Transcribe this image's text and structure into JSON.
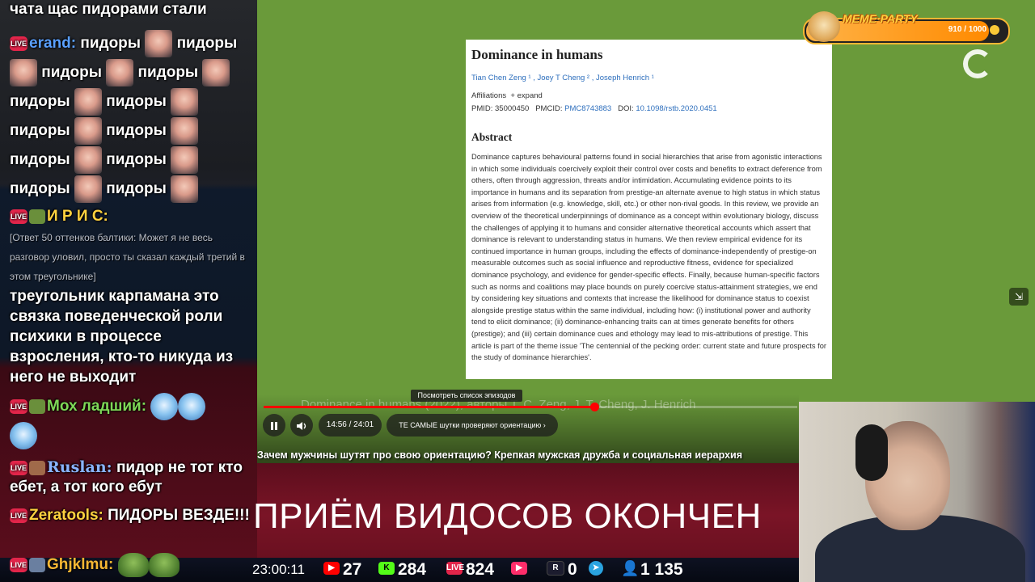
{
  "chat": {
    "msg0_text": "чата щас пидорами стали",
    "msg1_user": "erand:",
    "spam_word": "пидоры",
    "msg2_user": "И Р И С:",
    "msg2_quote": "[Ответ 50 оттенков балтики: Может я не весь разговор уловил, просто ты сказал каждый третий в этом треугольнике]",
    "msg3_text": "треугольник карпамана это связка поведенческой роли психики в процессе взросления, кто-то никуда из него не выходит",
    "msg4_user": "Мох ладший:",
    "msg5_user": "Ruslan:",
    "msg5_text": "пидор не тот кто ебет, а тот кого ебут",
    "msg6_user": "Zeratools:",
    "msg6_text": "ПИДОРЫ ВЕЗДЕ!!!",
    "msg7_user": "Ghjklmu:",
    "live_label": "LIVE",
    "user_colors": {
      "erand": "#5aa0ff",
      "iris": "#ffd23f",
      "moh": "#7ed957",
      "ruslan": "#8ab4ff",
      "zeratools": "#ffd23f",
      "ghjklmu": "#f7b733"
    }
  },
  "paper": {
    "title": "Dominance in humans",
    "authors": "Tian Chen Zeng ¹ , Joey T Cheng ² , Joseph Henrich ¹",
    "affiliations_label": "Affiliations",
    "expand_label": "expand",
    "pmid_label": "PMID: 35000450",
    "pmcid_label": "PMCID:",
    "pmcid_value": "PMC8743883",
    "doi_label": "DOI:",
    "doi_value": "10.1098/rstb.2020.0451",
    "abstract_heading": "Abstract",
    "abstract_text": "Dominance captures behavioural patterns found in social hierarchies that arise from agonistic interactions in which some individuals coercively exploit their control over costs and benefits to extract deference from others, often through aggression, threats and/or intimidation. Accumulating evidence points to its importance in humans and its separation from prestige-an alternate avenue to high status in which status arises from information (e.g. knowledge, skill, etc.) or other non-rival goods. In this review, we provide an overview of the theoretical underpinnings of dominance as a concept within evolutionary biology, discuss the challenges of applying it to humans and consider alternative theoretical accounts which assert that dominance is relevant to understanding status in humans. We then review empirical evidence for its continued importance in human groups, including the effects of dominance-independently of prestige-on measurable outcomes such as social influence and reproductive fitness, evidence for specialized dominance psychology, and evidence for gender-specific effects. Finally, because human-specific factors such as norms and coalitions may place bounds on purely coercive status-attainment strategies, we end by considering key situations and contexts that increase the likelihood for dominance status to coexist alongside prestige status within the same individual, including how: (i) institutional power and authority tend to elicit dominance; (ii) dominance-enhancing traits can at times generate benefits for others (prestige); and (iii) certain dominance cues and ethology may lead to mis-attributions of prestige. This article is part of the theme issue 'The centennial of the pecking order: current state and future prospects for the study of dominance hierarchies'."
  },
  "player": {
    "tooltip": "Посмотреть список эпизодов",
    "overlay_title": "Dominance in humans (2022), авторы T. C. Zeng, J. T. Cheng, J. Henrich",
    "time": "14:56 / 24:01",
    "chapter": "ТЕ САМЫЕ шутки проверяют ориентацию ›",
    "progress": 0.62,
    "video_title": "Зачем мужчины шутят про свою ориентацию? Крепкая мужская дружба и социальная иерархия",
    "pause_icon": "pause-icon",
    "volume_icon": "volume-icon"
  },
  "banner": {
    "text": "ПРИЁМ ВИДОСОВ ОКОНЧЕН"
  },
  "meme_party": {
    "title": "MEME·PARTY",
    "count": "910 / 1000",
    "progress": 0.91
  },
  "stats": {
    "clock": "23:00:11",
    "youtube": "27",
    "kick": "284",
    "vk_live": "824",
    "vk_video": "",
    "rutube": "0",
    "viewers": "1 135"
  }
}
